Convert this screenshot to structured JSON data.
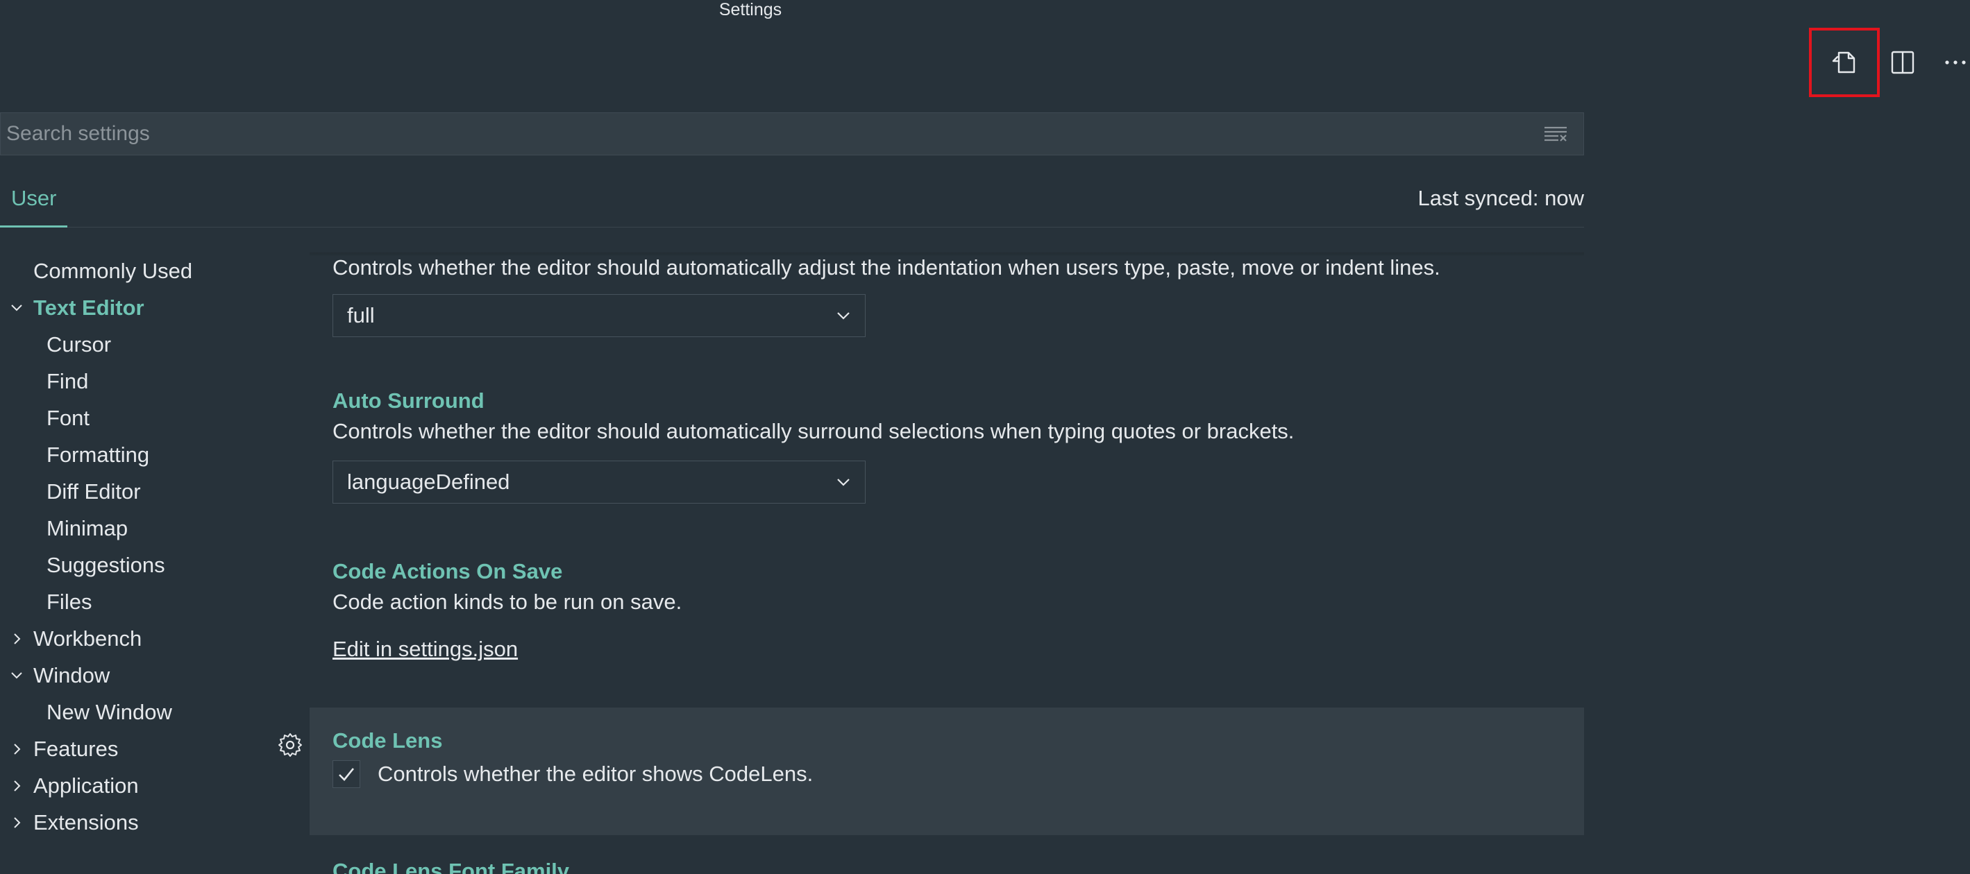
{
  "window": {
    "title": "Settings"
  },
  "top_actions": [
    {
      "icon": "open-settings-json-icon"
    },
    {
      "icon": "split-editor-icon"
    },
    {
      "icon": "more-actions-icon",
      "label": "···"
    }
  ],
  "search": {
    "placeholder": "Search settings",
    "value": ""
  },
  "tabs": {
    "user_label": "User",
    "sync_status": "Last synced: now"
  },
  "toc": {
    "items": [
      {
        "label": "Commonly Used"
      },
      {
        "label": "Text Editor"
      },
      {
        "label": "Cursor"
      },
      {
        "label": "Find"
      },
      {
        "label": "Font"
      },
      {
        "label": "Formatting"
      },
      {
        "label": "Diff Editor"
      },
      {
        "label": "Minimap"
      },
      {
        "label": "Suggestions"
      },
      {
        "label": "Files"
      },
      {
        "label": "Workbench"
      },
      {
        "label": "Window"
      },
      {
        "label": "New Window"
      },
      {
        "label": "Features"
      },
      {
        "label": "Application"
      },
      {
        "label": "Extensions"
      }
    ]
  },
  "settings": {
    "auto_indent": {
      "description": "Controls whether the editor should automatically adjust the indentation when users type, paste, move or indent lines.",
      "value": "full"
    },
    "auto_surround": {
      "title": "Auto Surround",
      "description": "Controls whether the editor should automatically surround selections when typing quotes or brackets.",
      "value": "languageDefined"
    },
    "code_actions_on_save": {
      "title": "Code Actions On Save",
      "description": "Code action kinds to be run on save.",
      "link": "Edit in settings.json"
    },
    "code_lens": {
      "title": "Code Lens",
      "description": "Controls whether the editor shows CodeLens.",
      "checked": true
    },
    "code_lens_font_family": {
      "title": "Code Lens Font Family"
    }
  }
}
